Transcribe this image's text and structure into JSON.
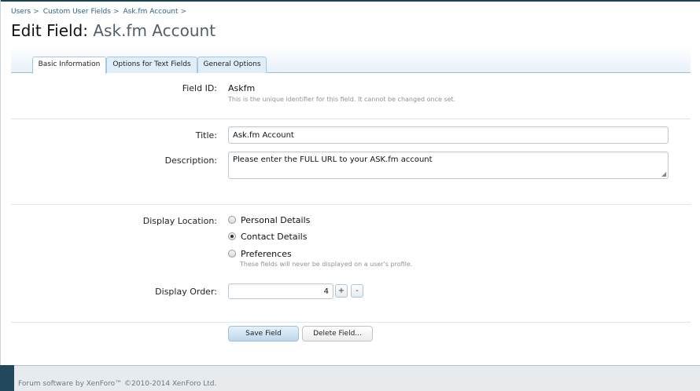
{
  "breadcrumb": {
    "items": [
      "Users",
      "Custom User Fields",
      "Ask.fm Account"
    ],
    "separator": ">"
  },
  "page": {
    "title_prefix": "Edit Field:",
    "title_name": "Ask.fm Account"
  },
  "tabs": [
    {
      "label": "Basic Information",
      "active": true
    },
    {
      "label": "Options for Text Fields",
      "active": false
    },
    {
      "label": "General Options",
      "active": false
    }
  ],
  "form": {
    "field_id": {
      "label": "Field ID:",
      "value": "Askfm",
      "hint": "This is the unique identifier for this field. It cannot be changed once set."
    },
    "title": {
      "label": "Title:",
      "value": "Ask.fm Account"
    },
    "description": {
      "label": "Description:",
      "value": "Please enter the FULL URL to your ASK.fm account"
    },
    "display_location": {
      "label": "Display Location:",
      "options": [
        "Personal Details",
        "Contact Details",
        "Preferences"
      ],
      "selected": "Contact Details",
      "hint": "These fields will never be displayed on a user's profile."
    },
    "display_order": {
      "label": "Display Order:",
      "value": "4",
      "plus": "+",
      "minus": "-"
    }
  },
  "buttons": {
    "save": "Save Field",
    "delete": "Delete Field..."
  },
  "footer": {
    "text": "Forum software by XenForo™ ©2010-2014 XenForo Ltd."
  },
  "colors": {
    "link": "#2d5f87",
    "tab_border": "#a7c6df",
    "footer_bar": "#24485c"
  }
}
